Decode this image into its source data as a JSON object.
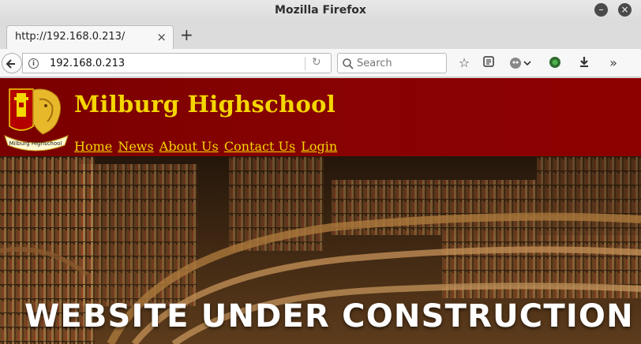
{
  "window": {
    "title": "Mozilla Firefox"
  },
  "tabs": [
    {
      "label": "http://192.168.0.213/"
    }
  ],
  "navbar": {
    "url": "192.168.0.213",
    "search_placeholder": "Search"
  },
  "site": {
    "title": "Milburg Highschool",
    "logo_text": "Milburg Highschool",
    "nav": [
      "Home",
      "News",
      "About Us",
      "Contact Us",
      "Login"
    ],
    "hero_text": "WEBSITE UNDER CONSTRUCTION"
  },
  "colors": {
    "header_bg": "#870202",
    "header_text": "#f4d600",
    "hero_text": "#ffffff"
  },
  "icons": [
    "back-icon",
    "info-icon",
    "reload-icon",
    "search-icon",
    "bookmark-star-icon",
    "reader-list-icon",
    "extension-mask-icon",
    "extension-green-icon",
    "download-icon",
    "overflow-icon",
    "minimize-icon",
    "close-icon",
    "new-tab-icon",
    "tab-close-icon"
  ]
}
